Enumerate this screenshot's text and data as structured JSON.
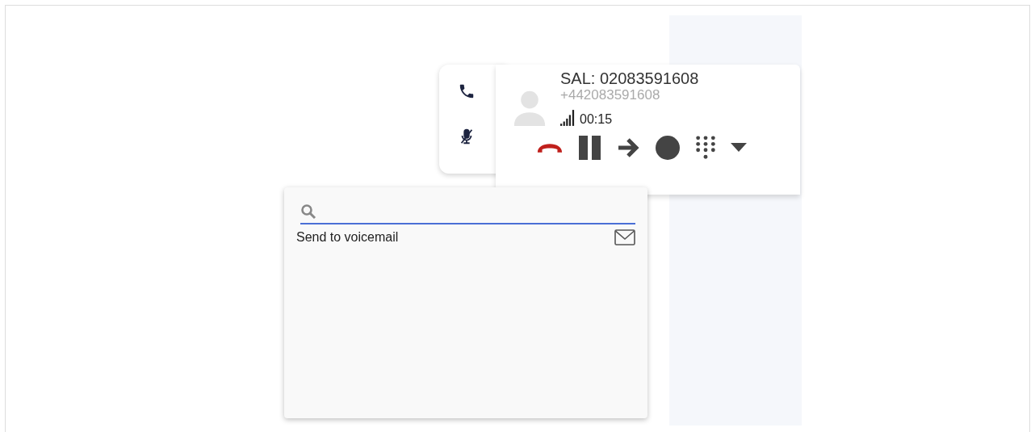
{
  "call": {
    "caller_name": "SAL: 02083591608",
    "caller_number": "+442083591608",
    "duration": "00:15",
    "muted": true
  },
  "transfer_menu": {
    "search": {
      "focused": true
    },
    "items": [
      {
        "label": "Send to voicemail",
        "kind": "voicemail"
      }
    ]
  }
}
